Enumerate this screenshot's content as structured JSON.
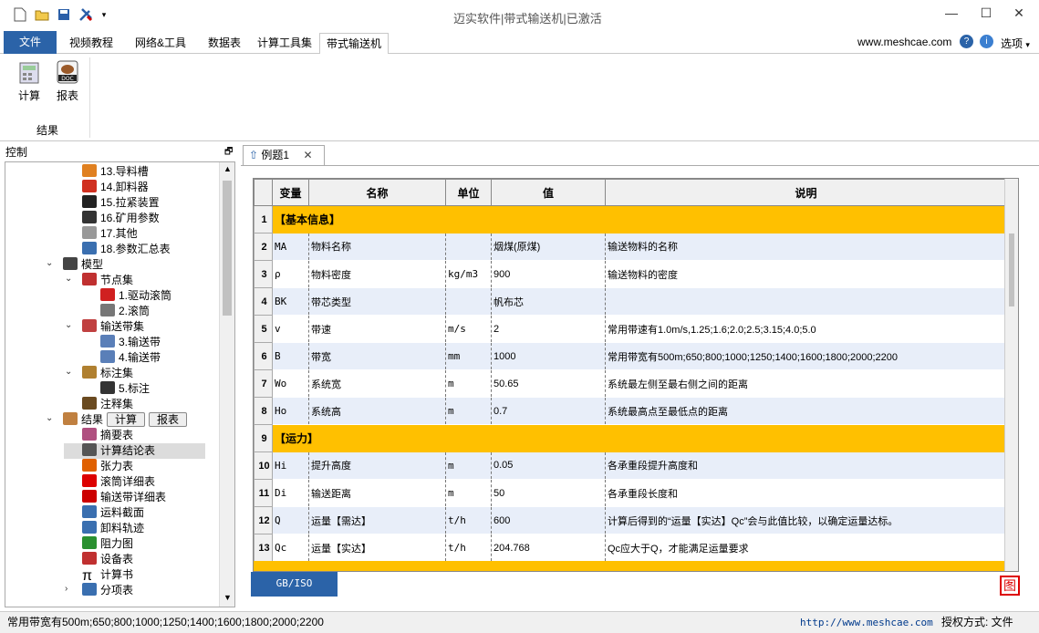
{
  "title": "迈实软件|带式输送机|已激活",
  "ribbon_tabs": [
    "文件",
    "视频教程",
    "网络&工具",
    "数据表",
    "计算工具集",
    "带式输送机"
  ],
  "site": "www.meshcae.com",
  "options_label": "选项",
  "ribbon_buttons": {
    "calc": "计算",
    "report": "报表",
    "group": "结果"
  },
  "control_header": "控制",
  "tree": [
    {
      "label": "13.导料槽",
      "icon": "chute-icon"
    },
    {
      "label": "14.卸料器",
      "icon": "unloader-icon"
    },
    {
      "label": "15.拉紧装置",
      "icon": "tensioner-icon"
    },
    {
      "label": "16.矿用参数",
      "icon": "mine-icon"
    },
    {
      "label": "17.其他",
      "icon": "other-icon"
    },
    {
      "label": "18.参数汇总表",
      "icon": "summary-icon"
    },
    {
      "label": "模型",
      "icon": "model-icon"
    },
    {
      "label": "节点集",
      "icon": "nodeset-icon"
    },
    {
      "label": "1.驱动滚筒",
      "icon": "drive-pulley-icon"
    },
    {
      "label": "2.滚筒",
      "icon": "pulley-icon"
    },
    {
      "label": "输送带集",
      "icon": "beltset-icon"
    },
    {
      "label": "3.输送带",
      "icon": "belt-icon"
    },
    {
      "label": "4.输送带",
      "icon": "belt-icon"
    },
    {
      "label": "标注集",
      "icon": "annotation-set-icon"
    },
    {
      "label": "5.标注",
      "icon": "annotation-icon"
    },
    {
      "label": "注释集",
      "icon": "notes-icon"
    },
    {
      "label": "结果",
      "icon": "results-icon"
    },
    {
      "label": "摘要表",
      "icon": "abstract-icon"
    },
    {
      "label": "计算结论表",
      "icon": "conclusion-icon"
    },
    {
      "label": "张力表",
      "icon": "tension-icon"
    },
    {
      "label": "滚筒详细表",
      "icon": "pulley-detail-icon"
    },
    {
      "label": "输送带详细表",
      "icon": "belt-detail-icon"
    },
    {
      "label": "运料截面",
      "icon": "section-icon"
    },
    {
      "label": "卸料轨迹",
      "icon": "trajectory-icon"
    },
    {
      "label": "阻力图",
      "icon": "resistance-icon"
    },
    {
      "label": "设备表",
      "icon": "equipment-icon"
    },
    {
      "label": "计算书",
      "icon": "pi-icon"
    },
    {
      "label": "分项表",
      "icon": "items-icon"
    }
  ],
  "tree_buttons": {
    "calc": "计算",
    "report": "报表"
  },
  "doc_tab": "例题1",
  "table": {
    "headers": [
      "变量",
      "名称",
      "单位",
      "值",
      "说明"
    ],
    "rows": [
      {
        "n": "1",
        "section": "【基本信息】"
      },
      {
        "n": "2",
        "var": "MA",
        "name": "物料名称",
        "unit": "",
        "val": "烟煤(原煤)",
        "desc": "输送物料的名称"
      },
      {
        "n": "3",
        "var": "ρ",
        "name": "物料密度",
        "unit": "kg/m3",
        "val": "900",
        "desc": "输送物料的密度"
      },
      {
        "n": "4",
        "var": "BK",
        "name": "带芯类型",
        "unit": "",
        "val": "帆布芯",
        "desc": ""
      },
      {
        "n": "5",
        "var": "v",
        "name": "带速",
        "unit": "m/s",
        "val": "2",
        "desc": "常用带速有1.0m/s,1.25;1.6;2.0;2.5;3.15;4.0;5.0"
      },
      {
        "n": "6",
        "var": "B",
        "name": "带宽",
        "unit": "mm",
        "val": "1000",
        "desc": "常用带宽有500m;650;800;1000;1250;1400;1600;1800;2000;2200"
      },
      {
        "n": "7",
        "var": "Wo",
        "name": "系统宽",
        "unit": "m",
        "val": "50.65",
        "desc": "系统最左侧至最右侧之间的距离"
      },
      {
        "n": "8",
        "var": "Ho",
        "name": "系统高",
        "unit": "m",
        "val": "0.7",
        "desc": "系统最高点至最低点的距离"
      },
      {
        "n": "9",
        "section": "【运力】"
      },
      {
        "n": "10",
        "var": "Hi",
        "name": "提升高度",
        "unit": "m",
        "val": "0.05",
        "desc": "各承重段提升高度和"
      },
      {
        "n": "11",
        "var": "Di",
        "name": "输送距离",
        "unit": "m",
        "val": "50",
        "desc": "各承重段长度和"
      },
      {
        "n": "12",
        "var": "Q",
        "name": "运量【需达】",
        "unit": "t/h",
        "val": "600",
        "desc": "计算后得到的“运量【实达】Qc”会与此值比较，以确定运量达标。"
      },
      {
        "n": "13",
        "var": "Qc",
        "name": "运量【实达】",
        "unit": "t/h",
        "val": "204.768",
        "desc": "Qc应大于Q，才能满足运量要求"
      }
    ]
  },
  "bottom_tab": "GB/ISO",
  "status": {
    "left": "常用带宽有500m;650;800;1000;1250;1400;1600;1800;2000;2200",
    "url": "http://www.meshcae.com",
    "auth": "授权方式: 文件"
  }
}
